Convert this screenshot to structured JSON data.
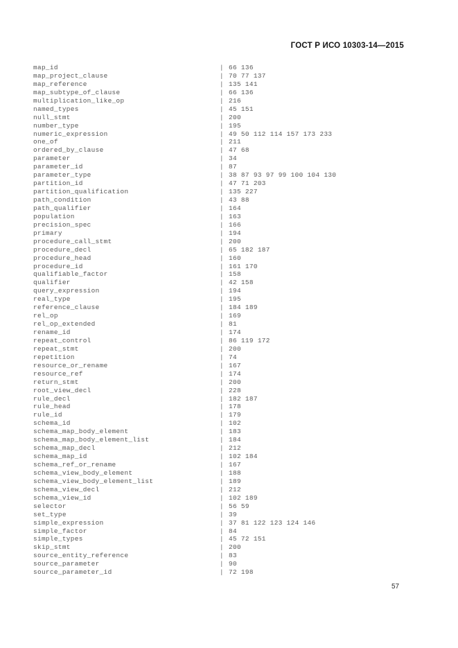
{
  "document": {
    "header_standard": "ГОСТ Р ИСО 10303-14—2015",
    "page_number": "57",
    "separator": "|"
  },
  "index": {
    "entries": [
      {
        "term": "map_id",
        "pages": "66 136"
      },
      {
        "term": "map_project_clause",
        "pages": "70 77 137"
      },
      {
        "term": "map_reference",
        "pages": "135 141"
      },
      {
        "term": "map_subtype_of_clause",
        "pages": "66 136"
      },
      {
        "term": "multiplication_like_op",
        "pages": "216"
      },
      {
        "term": "named_types",
        "pages": "45 151"
      },
      {
        "term": "null_stmt",
        "pages": "200"
      },
      {
        "term": "number_type",
        "pages": "195"
      },
      {
        "term": "numeric_expression",
        "pages": "49 50 112 114 157 173 233"
      },
      {
        "term": "one_of",
        "pages": "211"
      },
      {
        "term": "ordered_by_clause",
        "pages": "47 68"
      },
      {
        "term": "parameter",
        "pages": "34"
      },
      {
        "term": "parameter_id",
        "pages": "87"
      },
      {
        "term": "parameter_type",
        "pages": "38 87 93 97 99 100 104 130"
      },
      {
        "term": "partition_id",
        "pages": "47 71 203"
      },
      {
        "term": "partition_qualification",
        "pages": "135 227"
      },
      {
        "term": "path_condition",
        "pages": "43 88"
      },
      {
        "term": "path_qualifier",
        "pages": "164"
      },
      {
        "term": "population",
        "pages": "163"
      },
      {
        "term": "precision_spec",
        "pages": "166"
      },
      {
        "term": "primary",
        "pages": "194"
      },
      {
        "term": "procedure_call_stmt",
        "pages": "200"
      },
      {
        "term": "procedure_decl",
        "pages": "65 182 187"
      },
      {
        "term": "procedure_head",
        "pages": "160"
      },
      {
        "term": "procedure_id",
        "pages": "161 170"
      },
      {
        "term": "qualifiable_factor",
        "pages": "158"
      },
      {
        "term": "qualifier",
        "pages": "42 158"
      },
      {
        "term": "query_expression",
        "pages": "194"
      },
      {
        "term": "real_type",
        "pages": "195"
      },
      {
        "term": "reference_clause",
        "pages": "184 189"
      },
      {
        "term": "rel_op",
        "pages": "169"
      },
      {
        "term": "rel_op_extended",
        "pages": "81"
      },
      {
        "term": "rename_id",
        "pages": "174"
      },
      {
        "term": "repeat_control",
        "pages": "86 119 172"
      },
      {
        "term": "repeat_stmt",
        "pages": "200"
      },
      {
        "term": "repetition",
        "pages": "74"
      },
      {
        "term": "resource_or_rename",
        "pages": "167"
      },
      {
        "term": "resource_ref",
        "pages": "174"
      },
      {
        "term": "return_stmt",
        "pages": "200"
      },
      {
        "term": "root_view_decl",
        "pages": "228"
      },
      {
        "term": "rule_decl",
        "pages": "182 187"
      },
      {
        "term": "rule_head",
        "pages": "178"
      },
      {
        "term": "rule_id",
        "pages": "179"
      },
      {
        "term": "schema_id",
        "pages": "102"
      },
      {
        "term": "schema_map_body_element",
        "pages": "183"
      },
      {
        "term": "schema_map_body_element_list",
        "pages": "184"
      },
      {
        "term": "schema_map_decl",
        "pages": "212"
      },
      {
        "term": "schema_map_id",
        "pages": "102 184"
      },
      {
        "term": "schema_ref_or_rename",
        "pages": "167"
      },
      {
        "term": "schema_view_body_element",
        "pages": "188"
      },
      {
        "term": "schema_view_body_element_list",
        "pages": "189"
      },
      {
        "term": "schema_view_decl",
        "pages": "212"
      },
      {
        "term": "schema_view_id",
        "pages": "102 189"
      },
      {
        "term": "selector",
        "pages": "56 59"
      },
      {
        "term": "set_type",
        "pages": "39"
      },
      {
        "term": "simple_expression",
        "pages": "37 81 122 123 124 146"
      },
      {
        "term": "simple_factor",
        "pages": "84"
      },
      {
        "term": "simple_types",
        "pages": "45 72 151"
      },
      {
        "term": "skip_stmt",
        "pages": "200"
      },
      {
        "term": "source_entity_reference",
        "pages": "83"
      },
      {
        "term": "source_parameter",
        "pages": "90"
      },
      {
        "term": "source_parameter_id",
        "pages": "72 198"
      }
    ]
  }
}
